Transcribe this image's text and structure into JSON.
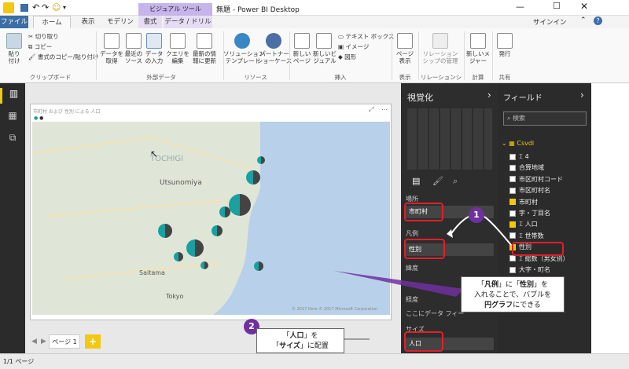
{
  "window": {
    "title": "無題 - Power BI Desktop",
    "signin": "サインイン",
    "help": "?"
  },
  "tabs": [
    "ファイル",
    "ホーム",
    "表示",
    "モデリング",
    "書式",
    "データ / ドリル"
  ],
  "context_tab": "ビジュアル ツール",
  "ribbon": {
    "clipboard": {
      "paste": "貼り\n付け",
      "cut": "切り取り",
      "copy": "コピー",
      "format_painter": "書式のコピー/貼り付け",
      "group": "クリップボード"
    },
    "external": {
      "get_data": "データを\n取得",
      "recent": "最近の\nソース",
      "enter": "データ\nの入力",
      "edit": "クエリを\n編集",
      "refresh": "最新の情\n報に更新",
      "group": "外部データ"
    },
    "resources": {
      "solution": "ソリューション\nテンプレート",
      "partner": "パートナー\nショーケース",
      "group": "リソース"
    },
    "insert": {
      "new_page": "新しい\nページ",
      "new_visual": "新しいビ\nジュアル",
      "textbox": "テキスト ボックス",
      "image": "イメージ",
      "shapes": "図形",
      "group": "挿入"
    },
    "view": {
      "page_view": "ページ\n表示",
      "group": "表示"
    },
    "relationships": {
      "manage": "リレーション\nシップの管理",
      "group": "リレーションシップ"
    },
    "calc": {
      "new_measure": "新しいメ\nジャー",
      "group": "計算"
    },
    "share": {
      "publish": "発行",
      "group": "共有"
    }
  },
  "map": {
    "title": "市町村 および 性別 による 人口",
    "places": [
      "Utsunomiya",
      "Saitama",
      "Tokyo",
      "TOCHIGI"
    ],
    "copyright": "© 2017 Here   © 2017 Microsoft Corporation"
  },
  "viz": {
    "title": "視覚化",
    "wells": {
      "location": "場所",
      "location_value": "市町村",
      "legend": "凡例",
      "legend_value": "性別",
      "lat": "緯度",
      "lon": "経度",
      "tooltip": "ここにデータ フィー",
      "size": "サイズ",
      "size_value": "人口"
    }
  },
  "fields": {
    "title": "フィールド",
    "search": "検索",
    "table": "Csvdl",
    "items": [
      {
        "label": "4",
        "checked": false,
        "sigma": true
      },
      {
        "label": "合算地域",
        "checked": false
      },
      {
        "label": "市区町村コード",
        "checked": false
      },
      {
        "label": "市区町村名",
        "checked": false
      },
      {
        "label": "市町村",
        "checked": true
      },
      {
        "label": "字・丁目名",
        "checked": false
      },
      {
        "label": "人口",
        "checked": true,
        "sigma": true
      },
      {
        "label": "世帯数",
        "checked": false,
        "sigma": true
      },
      {
        "label": "性別",
        "checked": true
      },
      {
        "label": "総数（男女別）",
        "checked": false,
        "sigma": true
      },
      {
        "label": "大字・町名",
        "checked": false
      },
      {
        "label": "年齢",
        "checked": false
      },
      {
        "label": "秘匿先情報",
        "checked": false
      }
    ]
  },
  "page_tab": "ページ 1",
  "status": "1/1 ページ",
  "callouts": {
    "one_num": "1",
    "one_text_html": "「<b>凡例</b>」に「<b>性別</b>」を\n入れることで、バブルを\n<b>円グラフ</b>にできる",
    "two_num": "2",
    "two_text_html": "「<b>人口</b>」を\n「<b>サイズ</b>」に配置"
  }
}
